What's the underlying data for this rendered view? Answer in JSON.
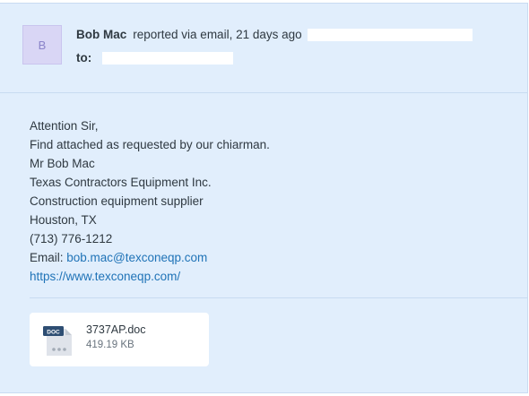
{
  "comment": {
    "avatar_initial": "B",
    "author": "Bob Mac",
    "via_text": "reported via email, 21 days ago",
    "to_label": "to:"
  },
  "body": {
    "lines": [
      "Attention Sir,",
      "Find attached as requested by our chiarman.",
      "Mr Bob Mac",
      "Texas Contractors Equipment Inc.",
      "Construction equipment supplier",
      "Houston, TX",
      "(713) 776-1212"
    ],
    "email_prefix": "Email: ",
    "email": "bob.mac@texconeqp.com",
    "website": "https://www.texconeqp.com/"
  },
  "attachment": {
    "icon": "doc-file-icon",
    "type_badge": "DOC",
    "name": "3737AP.doc",
    "size": "419.19 KB"
  },
  "colors": {
    "background": "#e1eefc",
    "link": "#1f73b7",
    "avatar": "#d9d6f5",
    "doc_badge": "#2e4e73"
  }
}
